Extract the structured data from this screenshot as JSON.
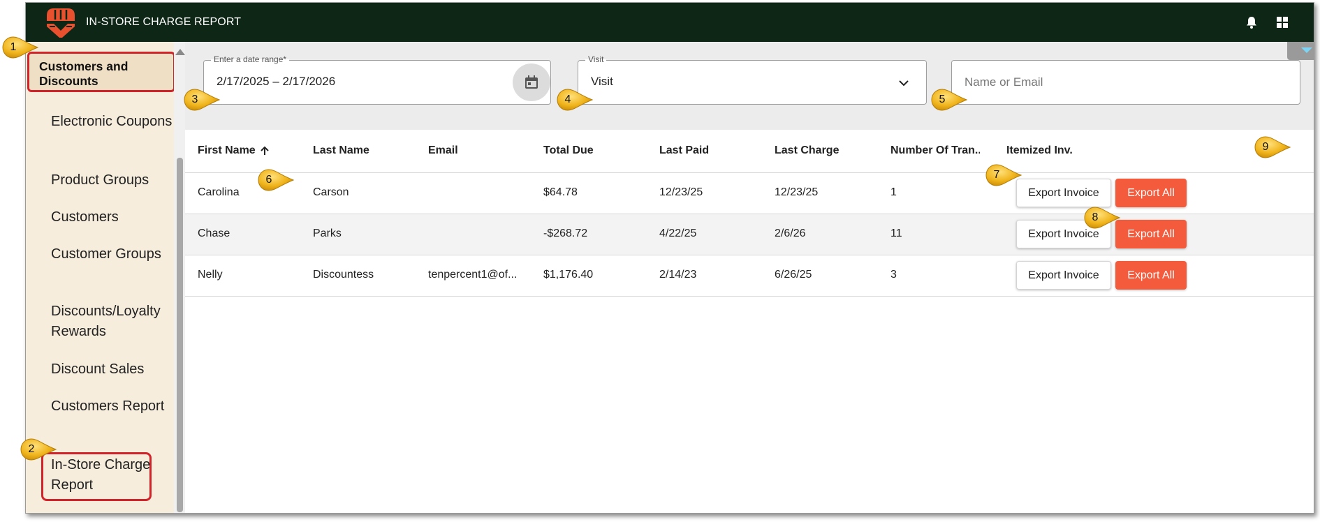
{
  "topbar": {
    "title": "IN-STORE CHARGE REPORT",
    "logo_icon": "brand-logo",
    "notification_icon": "bell-icon",
    "apps_icon": "grid-icon",
    "bg_color": "#0e2616",
    "logo_color": "#e8502e"
  },
  "sidebar": {
    "group_label": "Customers and Discounts",
    "items": [
      {
        "label": "Electronic Coupons"
      },
      {
        "label": "Product Groups"
      },
      {
        "label": "Customers"
      },
      {
        "label": "Customer Groups"
      },
      {
        "label": "Discounts/Loyalty Rewards"
      },
      {
        "label": "Discount Sales"
      },
      {
        "label": "Customers Report"
      },
      {
        "label": "In-Store Charge Report"
      }
    ],
    "selected_item": "In-Store Charge Report"
  },
  "filters": {
    "date_range": {
      "label": "Enter a date range*",
      "value": "2/17/2025 – 2/17/2026",
      "icon": "calendar-icon"
    },
    "visit": {
      "label": "Visit",
      "value": "Visit",
      "icon": "chevron-down-icon"
    },
    "search": {
      "placeholder": "Name or Email",
      "value": ""
    }
  },
  "table": {
    "columns": [
      "First Name",
      "Last Name",
      "Email",
      "Total Due",
      "Last Paid",
      "Last Charge",
      "Number Of Tran...",
      "Itemized Inv."
    ],
    "sort": {
      "column": "First Name",
      "direction": "ascending",
      "icon": "arrow-up-icon"
    },
    "rows": [
      {
        "first": "Carolina",
        "last": "Carson",
        "email": "",
        "total_due": "$64.78",
        "last_paid": "12/23/25",
        "last_charge": "12/23/25",
        "num_tran": "1"
      },
      {
        "first": "Chase",
        "last": "Parks",
        "email": "",
        "total_due": "-$268.72",
        "last_paid": "4/22/25",
        "last_charge": "2/6/26",
        "num_tran": "11"
      },
      {
        "first": "Nelly",
        "last": "Discountess",
        "email": "tenpercent1@of...",
        "total_due": "$1,176.40",
        "last_paid": "2/14/23",
        "last_charge": "6/26/25",
        "num_tran": "3"
      }
    ],
    "export_invoice_label": "Export Invoice",
    "export_all_label": "Export All",
    "export_all_color": "#f45a3c",
    "more_icon": "kebab-menu-icon"
  },
  "callouts": [
    "1",
    "2",
    "3",
    "4",
    "5",
    "6",
    "7",
    "8",
    "9"
  ],
  "callout_color": "#f0b41c",
  "highlight_color": "#d3232a"
}
